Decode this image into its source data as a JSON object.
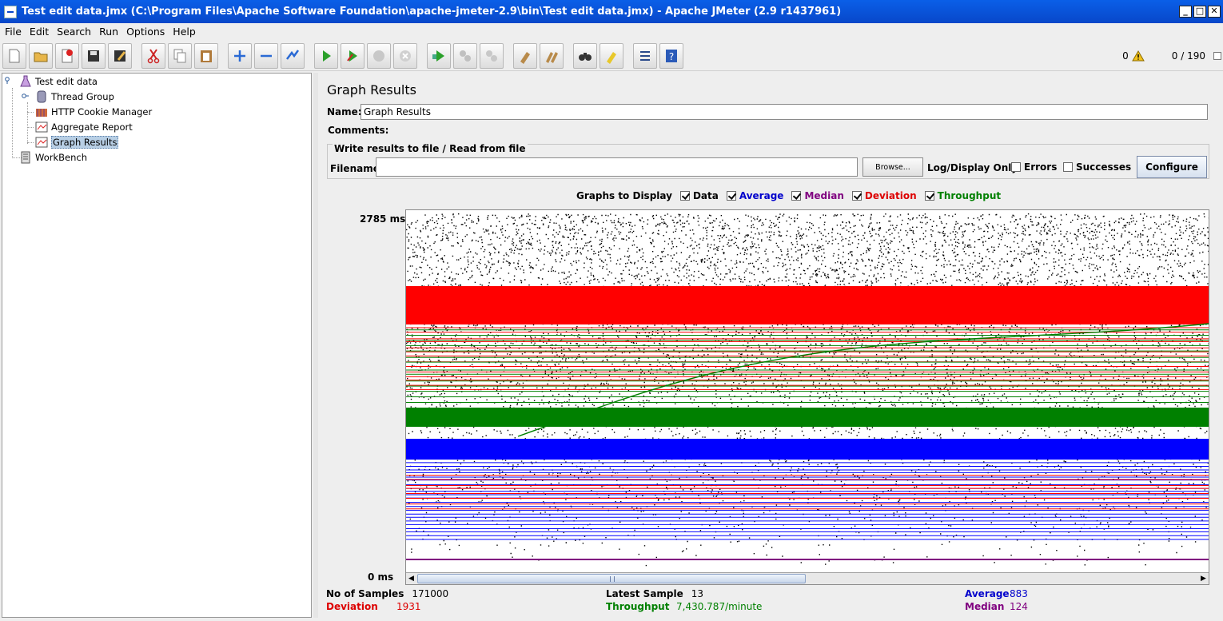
{
  "window": {
    "title": "Test edit data.jmx (C:\\Program Files\\Apache Software Foundation\\apache-jmeter-2.9\\bin\\Test edit data.jmx) - Apache JMeter (2.9 r1437961)",
    "buttons": [
      "_",
      "□",
      "✕"
    ]
  },
  "menu": [
    "File",
    "Edit",
    "Search",
    "Run",
    "Options",
    "Help"
  ],
  "toolbar": {
    "buttons": [
      "new-icon",
      "open-icon",
      "close-icon",
      "save-icon",
      "save-as-icon",
      "cut-icon",
      "copy-icon",
      "paste-icon",
      "expand-icon",
      "collapse-icon",
      "toggle-icon",
      "start-icon",
      "start-no-pauses-icon",
      "stop-icon",
      "shutdown-icon",
      "remote-start-icon",
      "remote-stop-icon",
      "remote-shutdown-icon",
      "clear-icon",
      "clear-all-icon",
      "search-icon",
      "reset-search-icon",
      "function-helper-icon",
      "help-icon"
    ],
    "error_count": "0",
    "threads": "0 / 190"
  },
  "tree": {
    "items": [
      {
        "label": "Test edit data",
        "icon": "test-plan-icon"
      },
      {
        "label": "Thread Group",
        "icon": "thread-group-icon"
      },
      {
        "label": "HTTP Cookie Manager",
        "icon": "cookie-manager-icon"
      },
      {
        "label": "Aggregate Report",
        "icon": "listener-icon"
      },
      {
        "label": "Graph Results",
        "icon": "listener-icon"
      },
      {
        "label": "WorkBench",
        "icon": "workbench-icon"
      }
    ],
    "selected": "Graph Results"
  },
  "panel": {
    "title": "Graph Results",
    "name_label": "Name:",
    "name_value": "Graph Results",
    "comments_label": "Comments:",
    "file_section_title": "Write results to file / Read from file",
    "filename_label": "Filename",
    "filename_value": "",
    "browse_label": "Browse...",
    "log_display_label": "Log/Display Only:",
    "errors_label": "Errors",
    "successes_label": "Successes",
    "configure_label": "Configure"
  },
  "graphs": {
    "label": "Graphs to Display",
    "options": [
      {
        "label": "Data",
        "checked": true,
        "color": "#000000"
      },
      {
        "label": "Average",
        "checked": true,
        "color": "#0000cc"
      },
      {
        "label": "Median",
        "checked": true,
        "color": "#800080"
      },
      {
        "label": "Deviation",
        "checked": true,
        "color": "#dd0000"
      },
      {
        "label": "Throughput",
        "checked": true,
        "color": "#008000"
      }
    ]
  },
  "chart_data": {
    "type": "scatter",
    "y_axis_max_label": "2785 ms",
    "y_axis_min_label": "0 ms",
    "colors": {
      "data": "#000000",
      "average": "#0000ff",
      "median": "#800080",
      "deviation": "#ff0000",
      "throughput": "#008000"
    }
  },
  "stats": {
    "samples_label": "No of Samples",
    "samples_value": "171000",
    "deviation_label": "Deviation",
    "deviation_value": "1931",
    "latest_label": "Latest Sample",
    "latest_value": "13",
    "throughput_label": "Throughput",
    "throughput_value": "7,430.787/minute",
    "average_label": "Average",
    "average_value": "883",
    "median_label": "Median",
    "median_value": "124"
  }
}
